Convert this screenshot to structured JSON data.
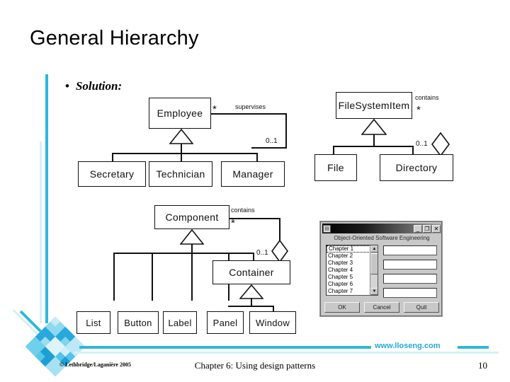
{
  "slide": {
    "title": "General Hierarchy",
    "bullet_marker": "•",
    "bullet_text": "Solution:",
    "accent_color": "#2EB8DC",
    "accent_pale_color": "#D7EFF7"
  },
  "diagram_employee": {
    "superclass": "Employee",
    "subclasses": [
      "Secretary",
      "Technician",
      "Manager"
    ],
    "association_label": "supervises",
    "multiplicity_many": "*",
    "multiplicity_one": "0..1"
  },
  "diagram_filesystem": {
    "superclass": "FileSystemItem",
    "subclasses": [
      "File",
      "Directory"
    ],
    "association_label": "contains",
    "multiplicity_many": "*",
    "multiplicity_one": "0..1"
  },
  "diagram_component": {
    "superclass": "Component",
    "container": "Container",
    "subclasses": [
      "List",
      "Button",
      "Label",
      "Panel",
      "Window"
    ],
    "association_label": "contains",
    "multiplicity_many": "*",
    "multiplicity_one": "0..1"
  },
  "app_window": {
    "title_bar_text": "",
    "icon_glyph": "▤",
    "minimize_label": "_",
    "maximize_label": "❐",
    "close_label": "✕",
    "caption": "Object-Oriented Software Engineering",
    "list_items": [
      "Chapter 1",
      "Chapter 2",
      "Chapter 3",
      "Chapter 4",
      "Chapter 5",
      "Chapter 6",
      "Chapter 7"
    ],
    "scroll_up_glyph": "▲",
    "scroll_down_glyph": "▼",
    "text_fields": [
      "",
      "",
      "",
      ""
    ],
    "buttons": [
      "OK",
      "Cancel",
      "Quit"
    ]
  },
  "footer": {
    "url": "www.lloseng.com",
    "copyright": "© Lethbridge/Laganière 2005",
    "chapter": "Chapter 6: Using design patterns",
    "page_number": "10"
  }
}
